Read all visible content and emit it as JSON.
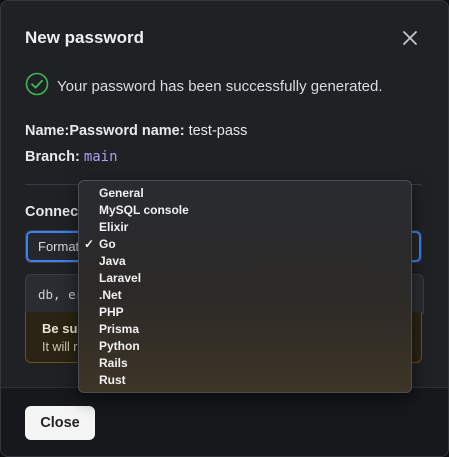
{
  "modal": {
    "title": "New password",
    "success_message": "Your password has been successfully generated.",
    "name_label": "Name:Password name:",
    "name_value": "test-pass",
    "branch_label": "Branch:",
    "branch_value": "main",
    "connect_label": "Connect",
    "format_label": "Format",
    "code_snippet": "db, er",
    "warning_title": "Be sur",
    "warning_text": "It will r",
    "close_button": "Close"
  },
  "dropdown": {
    "selected": "Go",
    "options": [
      "General",
      "MySQL console",
      "Elixir",
      "Go",
      "Java",
      "Laravel",
      ".Net",
      "PHP",
      "Prisma",
      "Python",
      "Rails",
      "Rust"
    ]
  },
  "colors": {
    "success": "#3fb950",
    "accent": "#3b82f6",
    "branch_code": "#b29cf0"
  }
}
